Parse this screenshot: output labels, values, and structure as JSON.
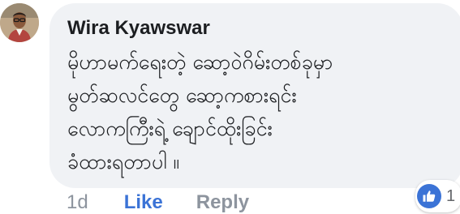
{
  "comment": {
    "author": "Wira Kyawswar",
    "text": "မိုဟာမက်ရေးတဲ့ ဆော့ဝဲဂိမ်းတစ်ခုမှာ\nမွတ်ဆလင်တွေ ဆော့ကစားရင်း\nလောကကြီးရဲ့ ချောင်ထိုးခြင်း\nခံထားရတာပါ ။",
    "time": "1d",
    "like_label": "Like",
    "reply_label": "Reply",
    "reaction_count": "1",
    "reaction_icon": "thumbs-up-icon"
  },
  "colors": {
    "bubble": "#f0f2f5",
    "link_blue": "#3b73d6",
    "muted": "#8d949e"
  }
}
